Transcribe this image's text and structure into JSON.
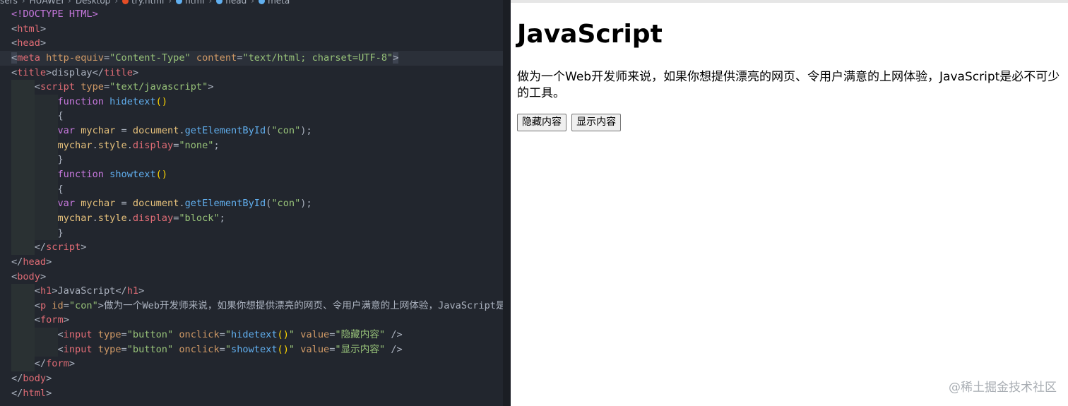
{
  "editor": {
    "breadcrumb": [
      "sers",
      "HUAWEI",
      "Desktop",
      "try.html",
      "html",
      "head",
      "meta"
    ],
    "code_lines": [
      {
        "indent": 0,
        "parts": [
          [
            "doctype",
            "<!DOCTYPE HTML>"
          ]
        ]
      },
      {
        "indent": 0,
        "parts": [
          [
            "punc",
            "<"
          ],
          [
            "tag",
            "html"
          ],
          [
            "punc",
            ">"
          ]
        ]
      },
      {
        "indent": 0,
        "parts": [
          [
            "punc",
            "<"
          ],
          [
            "tag",
            "head"
          ],
          [
            "punc",
            ">"
          ]
        ]
      },
      {
        "indent": 0,
        "hl": true,
        "parts": [
          [
            "sel",
            "<"
          ],
          [
            "tag",
            "meta"
          ],
          [
            "attr",
            " http-equiv"
          ],
          [
            "punc",
            "="
          ],
          [
            "str",
            "\"Content-Type\""
          ],
          [
            "attr",
            " content"
          ],
          [
            "punc",
            "="
          ],
          [
            "str",
            "\"text/html; charset=UTF-8\""
          ],
          [
            "sel",
            ">"
          ]
        ]
      },
      {
        "indent": 0,
        "parts": [
          [
            "punc",
            "<"
          ],
          [
            "tag",
            "title"
          ],
          [
            "punc",
            ">display</"
          ],
          [
            "tag",
            "title"
          ],
          [
            "punc",
            ">"
          ]
        ]
      },
      {
        "indent": 1,
        "parts": [
          [
            "punc",
            "<"
          ],
          [
            "tag",
            "script"
          ],
          [
            "attr",
            " type"
          ],
          [
            "punc",
            "="
          ],
          [
            "str",
            "\"text/javascript\""
          ],
          [
            "punc",
            ">"
          ]
        ]
      },
      {
        "indent": 2,
        "parts": [
          [
            "kw",
            "function"
          ],
          [
            "fn",
            " hidetext"
          ],
          [
            "bracket",
            "()"
          ]
        ]
      },
      {
        "indent": 2,
        "parts": [
          [
            "punc",
            "{"
          ]
        ]
      },
      {
        "indent": 2,
        "parts": [
          [
            "kw",
            "var"
          ],
          [
            "var",
            " mychar"
          ],
          [
            "punc",
            " = "
          ],
          [
            "var",
            "document"
          ],
          [
            "punc",
            "."
          ],
          [
            "fn",
            "getElementById"
          ],
          [
            "punc",
            "("
          ],
          [
            "str",
            "\"con\""
          ],
          [
            "punc",
            ");"
          ]
        ]
      },
      {
        "indent": 2,
        "parts": [
          [
            "var",
            "mychar"
          ],
          [
            "punc",
            "."
          ],
          [
            "var",
            "style"
          ],
          [
            "punc",
            "."
          ],
          [
            "tag",
            "display"
          ],
          [
            "punc",
            "="
          ],
          [
            "str",
            "\"none\""
          ],
          [
            "punc",
            ";"
          ]
        ]
      },
      {
        "indent": 2,
        "parts": [
          [
            "punc",
            "}"
          ]
        ]
      },
      {
        "indent": 2,
        "parts": [
          [
            "kw",
            "function"
          ],
          [
            "fn",
            " showtext"
          ],
          [
            "bracket",
            "()"
          ]
        ]
      },
      {
        "indent": 2,
        "parts": [
          [
            "punc",
            "{"
          ]
        ]
      },
      {
        "indent": 2,
        "parts": [
          [
            "kw",
            "var"
          ],
          [
            "var",
            " mychar"
          ],
          [
            "punc",
            " = "
          ],
          [
            "var",
            "document"
          ],
          [
            "punc",
            "."
          ],
          [
            "fn",
            "getElementById"
          ],
          [
            "punc",
            "("
          ],
          [
            "str",
            "\"con\""
          ],
          [
            "punc",
            ");"
          ]
        ]
      },
      {
        "indent": 2,
        "parts": [
          [
            "var",
            "mychar"
          ],
          [
            "punc",
            "."
          ],
          [
            "var",
            "style"
          ],
          [
            "punc",
            "."
          ],
          [
            "tag",
            "display"
          ],
          [
            "punc",
            "="
          ],
          [
            "str",
            "\"block\""
          ],
          [
            "punc",
            ";"
          ]
        ]
      },
      {
        "indent": 2,
        "parts": [
          [
            "punc",
            "}"
          ]
        ]
      },
      {
        "indent": 1,
        "parts": [
          [
            "punc",
            "</"
          ],
          [
            "tag",
            "script"
          ],
          [
            "punc",
            ">"
          ]
        ]
      },
      {
        "indent": 0,
        "parts": [
          [
            "punc",
            "</"
          ],
          [
            "tag",
            "head"
          ],
          [
            "punc",
            ">"
          ]
        ]
      },
      {
        "indent": 0,
        "parts": [
          [
            "punc",
            "<"
          ],
          [
            "tag",
            "body"
          ],
          [
            "punc",
            ">"
          ]
        ]
      },
      {
        "indent": 1,
        "parts": [
          [
            "punc",
            "<"
          ],
          [
            "tag",
            "h1"
          ],
          [
            "punc",
            ">JavaScript</"
          ],
          [
            "tag",
            "h1"
          ],
          [
            "punc",
            ">"
          ]
        ]
      },
      {
        "indent": 1,
        "parts": [
          [
            "punc",
            "<"
          ],
          [
            "tag",
            "p"
          ],
          [
            "attr",
            " id"
          ],
          [
            "punc",
            "="
          ],
          [
            "str",
            "\"con\""
          ],
          [
            "punc",
            ">做为一个Web开发师来说，如果你想提供漂亮的网页、令用户满意的上网体验，JavaScript是必不可少的工具。"
          ]
        ]
      },
      {
        "indent": 1,
        "parts": [
          [
            "punc",
            "<"
          ],
          [
            "tag",
            "form"
          ],
          [
            "punc",
            ">"
          ]
        ]
      },
      {
        "indent": 2,
        "parts": [
          [
            "punc",
            "<"
          ],
          [
            "tag",
            "input"
          ],
          [
            "attr",
            " type"
          ],
          [
            "punc",
            "="
          ],
          [
            "str",
            "\"button\""
          ],
          [
            "attr",
            " onclick"
          ],
          [
            "punc",
            "="
          ],
          [
            "str",
            "\""
          ],
          [
            "fn",
            "hidetext"
          ],
          [
            "bracket",
            "()"
          ],
          [
            "str",
            "\""
          ],
          [
            "attr",
            " value"
          ],
          [
            "punc",
            "="
          ],
          [
            "str",
            "\"隐藏内容\""
          ],
          [
            "punc",
            " />"
          ]
        ]
      },
      {
        "indent": 2,
        "parts": [
          [
            "punc",
            "<"
          ],
          [
            "tag",
            "input"
          ],
          [
            "attr",
            " type"
          ],
          [
            "punc",
            "="
          ],
          [
            "str",
            "\"button\""
          ],
          [
            "attr",
            " onclick"
          ],
          [
            "punc",
            "="
          ],
          [
            "str",
            "\""
          ],
          [
            "fn",
            "showtext"
          ],
          [
            "bracket",
            "()"
          ],
          [
            "str",
            "\""
          ],
          [
            "attr",
            " value"
          ],
          [
            "punc",
            "="
          ],
          [
            "str",
            "\"显示内容\""
          ],
          [
            "punc",
            " />"
          ]
        ]
      },
      {
        "indent": 1,
        "parts": [
          [
            "punc",
            "</"
          ],
          [
            "tag",
            "form"
          ],
          [
            "punc",
            ">"
          ]
        ]
      },
      {
        "indent": 0,
        "parts": [
          [
            "punc",
            "</"
          ],
          [
            "tag",
            "body"
          ],
          [
            "punc",
            ">"
          ]
        ]
      },
      {
        "indent": 0,
        "parts": [
          [
            "punc",
            "</"
          ],
          [
            "tag",
            "html"
          ],
          [
            "punc",
            ">"
          ]
        ]
      }
    ]
  },
  "preview": {
    "heading": "JavaScript",
    "paragraph": "做为一个Web开发师来说，如果你想提供漂亮的网页、令用户满意的上网体验，JavaScript是必不可少的工具。",
    "hide_button": "隐藏内容",
    "show_button": "显示内容"
  },
  "watermark": "@稀土掘金技术社区",
  "colors": {
    "editor_bg": "#22262e",
    "tag": "#e06c75",
    "attr": "#d19a66",
    "string": "#98c379",
    "keyword": "#c678dd",
    "function": "#61afef",
    "variable": "#e5c07b"
  }
}
